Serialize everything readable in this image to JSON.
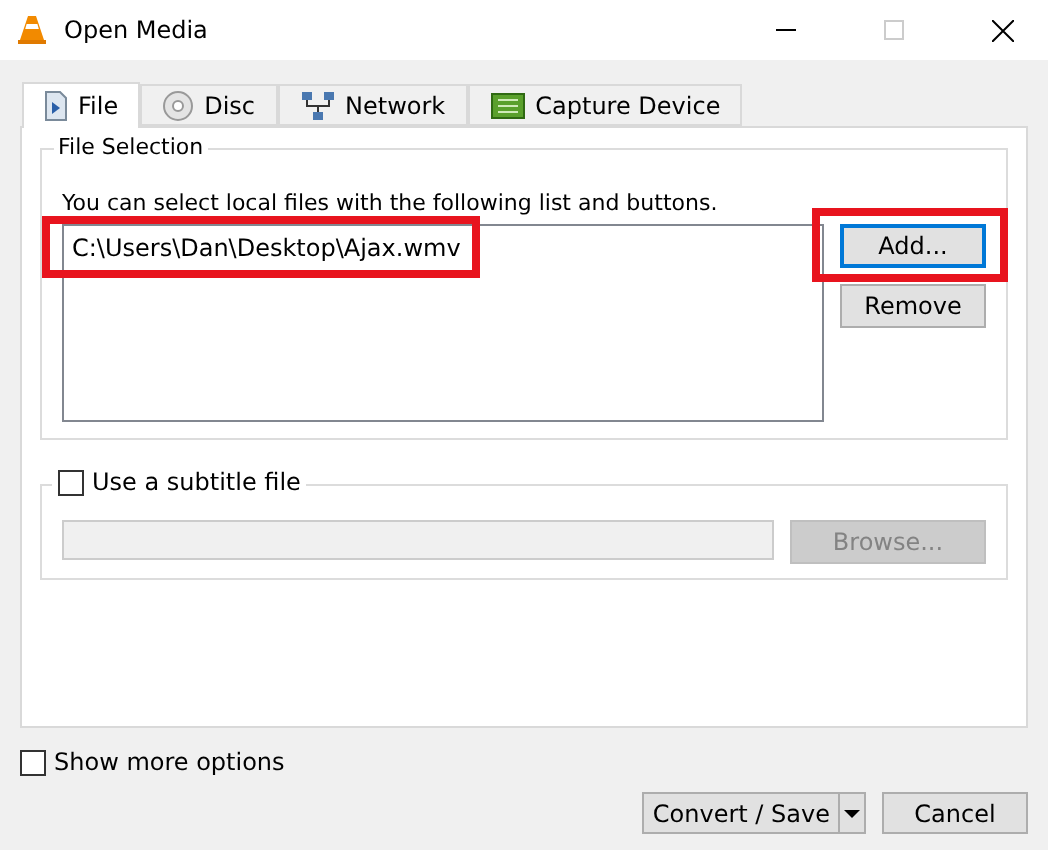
{
  "window": {
    "title": "Open Media"
  },
  "tabs": [
    {
      "label": "File",
      "selected": true
    },
    {
      "label": "Disc",
      "selected": false
    },
    {
      "label": "Network",
      "selected": false
    },
    {
      "label": "Capture Device",
      "selected": false
    }
  ],
  "file_selection": {
    "title": "File Selection",
    "hint": "You can select local files with the following list and buttons.",
    "files": [
      {
        "path": "C:\\Users\\Dan\\Desktop\\Ajax.wmv",
        "highlighted": true
      }
    ],
    "buttons": [
      {
        "label": "Add...",
        "focused": true,
        "highlighted": true
      },
      {
        "label": "Remove",
        "focused": false,
        "highlighted": false
      }
    ]
  },
  "subtitle": {
    "label": "Use a subtitle file",
    "checked": false,
    "browse": {
      "label": "Browse...",
      "disabled": true
    }
  },
  "show_more_options": {
    "label": "Show more options",
    "checked": false
  },
  "footer": {
    "convert": "Convert / Save",
    "cancel": "Cancel"
  }
}
